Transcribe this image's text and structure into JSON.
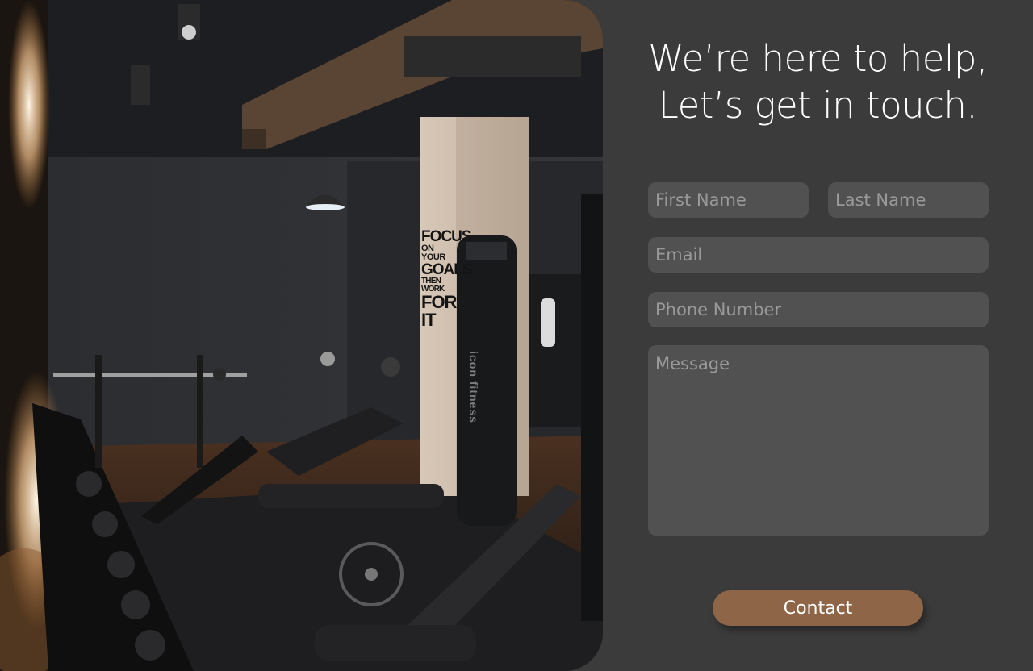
{
  "hero": {
    "poster_lines": [
      "FOCUS",
      "ON YOUR",
      "GOALS",
      "THEN WORK",
      "FOR IT"
    ],
    "machine_brand": "icon fitness"
  },
  "contact": {
    "headline_line1": "We’re here to help,",
    "headline_line2": "Let’s get in touch.",
    "first_name_placeholder": "First Name",
    "last_name_placeholder": "Last Name",
    "email_placeholder": "Email",
    "phone_placeholder": "Phone Number",
    "message_placeholder": "Message",
    "submit_label": "Contact"
  },
  "colors": {
    "panel_bg": "#3b3b3b",
    "field_bg": "#515151",
    "button_bg": "#8f6548",
    "text": "#ffffff",
    "placeholder": "#9a9a9a"
  }
}
